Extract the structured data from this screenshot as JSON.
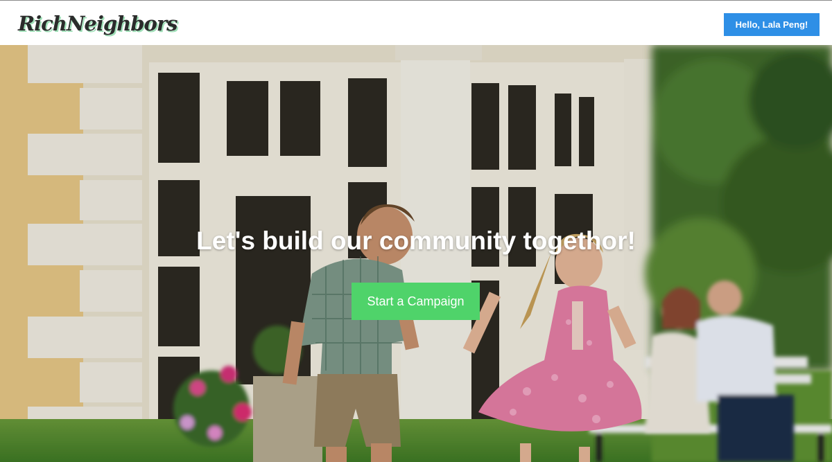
{
  "header": {
    "logo_text": "RichNeighbors",
    "user_button_label": "Hello, Lala Peng!"
  },
  "hero": {
    "title": "Let's build our community togethor!",
    "cta_label": "Start a Campaign",
    "image": "family-playing-in-front-of-house-photo"
  },
  "colors": {
    "accent_blue": "#2e8fe6",
    "cta_green": "#4fd36a",
    "logo_shadow_green": "#9fe0b8"
  }
}
